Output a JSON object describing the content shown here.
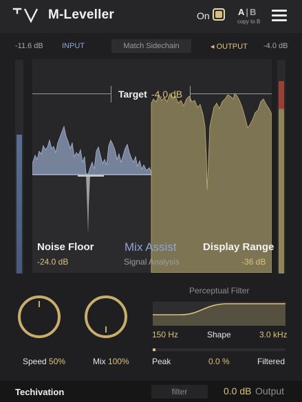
{
  "header": {
    "title": "M-Leveller",
    "on_label": "On",
    "ab_a": "A",
    "ab_sep": "|",
    "ab_b": "B",
    "copy_label": "copy to B"
  },
  "io": {
    "input_db": "-11.6 dB",
    "input_label": "INPUT",
    "match_sidechain": "Match Sidechain",
    "output_label": "◂ OUTPUT",
    "output_db": "-4.0 dB",
    "input_meter_level": 0.65,
    "output_meter_level": 0.9
  },
  "display": {
    "target_label": "Target",
    "target_value": "-4.0 dB",
    "noise_floor_label": "Noise Floor",
    "noise_floor_value": "-24.0 dB",
    "mix_assist_label": "Mix Assist",
    "signal_analysis_label": "Signal Analysis",
    "display_range_label": "Display Range",
    "display_range_value": "-36 dB"
  },
  "controls": {
    "speed_label": "Speed",
    "speed_value": "50%",
    "speed_fraction": 0.5,
    "mix_label": "Mix",
    "mix_value": "100%",
    "mix_fraction": 1.0
  },
  "perceptual_filter": {
    "title": "Perceptual Filter",
    "low_freq": "150 Hz",
    "shape_label": "Shape",
    "high_freq": "3.0 kHz",
    "peak_label": "Peak",
    "peak_value": "0.0 %",
    "peak_fraction": 0.0,
    "filtered_label": "Filtered"
  },
  "footer": {
    "brand": "Techivation",
    "filter_button": "filter",
    "output_db": "0.0 dB",
    "output_label": "Output"
  },
  "colors": {
    "accent_gold": "#dcc27b",
    "accent_blue": "#8ea4d6",
    "input_meter": "#5a6d92",
    "output_meter": "#8f8458",
    "output_meter_clip": "#9b3f35"
  },
  "icons": {
    "logo": "tv-logo-icon",
    "menu": "hamburger-menu-icon"
  }
}
